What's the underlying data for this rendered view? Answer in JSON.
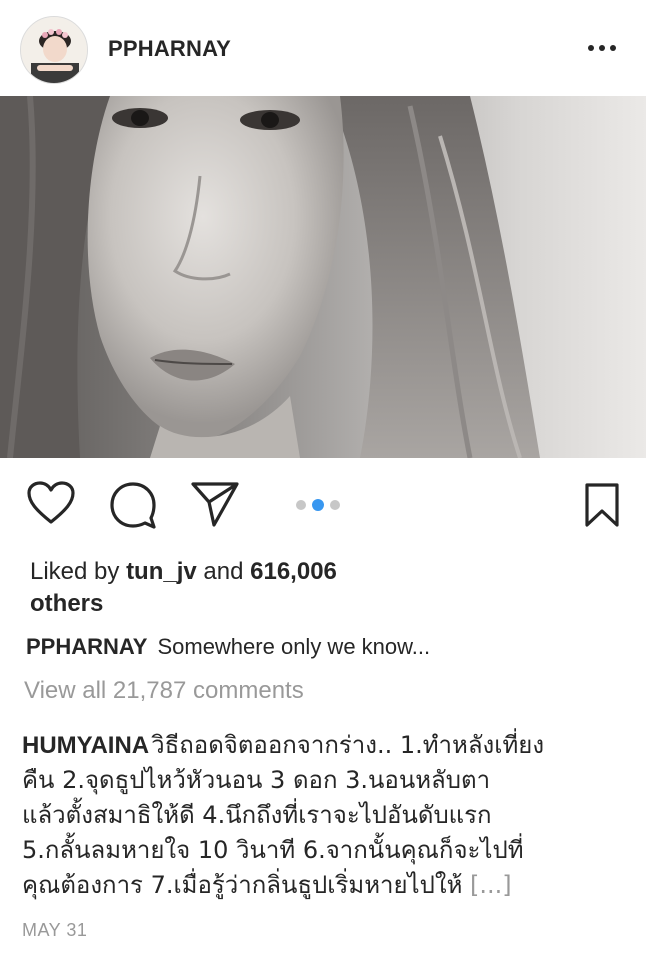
{
  "post": {
    "username": "PPHARNAY",
    "avatar_icon": "avatar-photo",
    "more_icon": "more-options-icon",
    "carousel": {
      "count": 3,
      "active_index": 1
    }
  },
  "actions": {
    "like_icon": "heart-icon",
    "comment_icon": "comment-bubble-icon",
    "share_icon": "send-icon",
    "save_icon": "bookmark-icon"
  },
  "likes": {
    "prefix": "Liked by",
    "user": "tun_jv",
    "joiner": "and",
    "count": "616,006",
    "suffix": "others"
  },
  "caption": {
    "username": "PPHARNAY",
    "text": "Somewhere only we know..."
  },
  "view_all": "View all 21,787 comments",
  "comment": {
    "username": "HUMYAINA",
    "lines": [
      "วิธีถอดจิตออกจากร่าง.. 1.ทำหลังเที่ยง",
      "คืน   2.จุดธูปไหว้หัวนอน 3 ดอก   3.นอนหลับตา",
      "แล้วตั้งสมาธิให้ดี   4.นึกถึงที่เราจะไปอันดับแรก",
      "5.กลั้นลมหายใจ 10 วินาที   6.จากนั้นคุณก็จะไปที่",
      "คุณต้องการ   7.เมื่อรู้ว่ากลิ่นธูปเริ่มหายไปให้ "
    ],
    "more": "[...]"
  },
  "date": "MAY 31",
  "colors": {
    "text": "#262626",
    "muted": "#999999",
    "accent": "#3897f0"
  }
}
